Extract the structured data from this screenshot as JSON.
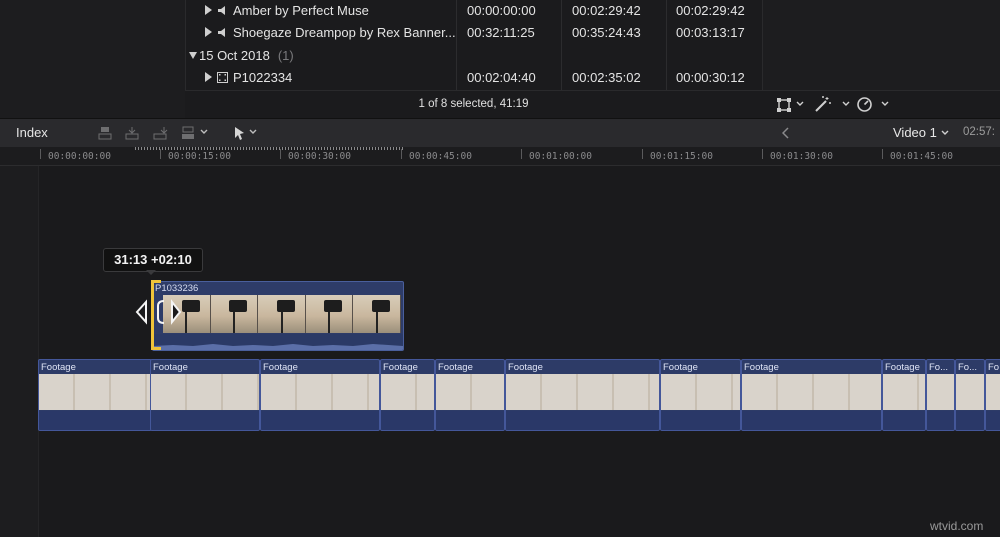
{
  "browser": {
    "rows": [
      {
        "name": "Amber by Perfect Muse",
        "tc_start": "00:00:00:00",
        "tc_end": "00:02:29:42",
        "tc_dur": "00:02:29:42",
        "icon": "audio-icon"
      },
      {
        "name": "Shoegaze Dreampop by Rex Banner...",
        "tc_start": "00:32:11:25",
        "tc_end": "00:35:24:43",
        "tc_dur": "00:03:13:17",
        "icon": "audio-icon"
      },
      {
        "name": "P1022334",
        "tc_start": "00:02:04:40",
        "tc_end": "00:02:35:02",
        "tc_dur": "00:00:30:12",
        "icon": "film-icon"
      }
    ],
    "date_group": {
      "label": "15 Oct 2018",
      "count": "(1)"
    },
    "status": "1 of 8 selected, 41:19"
  },
  "timeline_toolbar": {
    "index_label": "Index",
    "video_label": "Video 1",
    "timecode": "02:57:"
  },
  "ruler": {
    "ticks": [
      "00:00:00:00",
      "00:00:15:00",
      "00:00:30:00",
      "00:00:45:00",
      "00:01:00:00",
      "00:01:15:00",
      "00:01:30:00",
      "00:01:45:00"
    ]
  },
  "tooltip": {
    "text": "31:13  +02:10"
  },
  "connected_clip": {
    "name": "P1033236"
  },
  "storyline_clips": [
    "Footage",
    "Footage",
    "Footage",
    "Footage",
    "Footage",
    "Footage",
    "Footage",
    "Footage",
    "Footage",
    "Fo...",
    "Fo...",
    "Fo..."
  ],
  "watermark": "wtvid.com",
  "colors": {
    "clip_blue": "#2d3b67",
    "trim_yellow": "#f0c43a",
    "background": "#1a1a1c"
  }
}
